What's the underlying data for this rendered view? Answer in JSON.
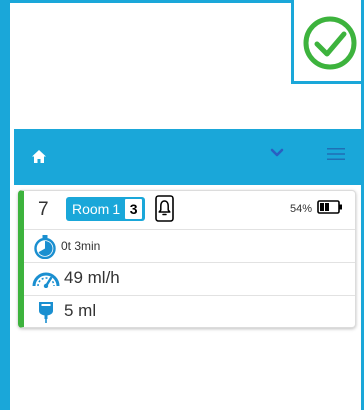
{
  "colors": {
    "accent": "#1aa7d9",
    "status_green": "#3db33d",
    "check_green": "#3db33d"
  },
  "status": {
    "icon": "check-circle-icon"
  },
  "header": {
    "home_icon": "home-icon",
    "chevron_icon": "chevron-down-icon",
    "menu_icon": "hamburger-menu-icon"
  },
  "patient_card": {
    "bed_number": "7",
    "room_label": "Room",
    "room_number": "1",
    "bed_box": "3",
    "device_icon": "phone-bell-icon",
    "battery_percent": "54%",
    "battery_level": 0.54,
    "timer_value": "0t 3min",
    "rate_value": "49 ml/h",
    "volume_value": "5 ml"
  }
}
